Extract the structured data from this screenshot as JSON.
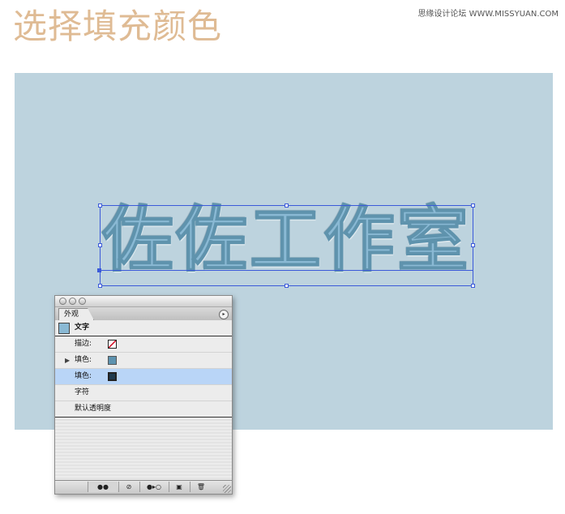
{
  "page": {
    "title": "选择填充颜色",
    "watermark": "思缘设计论坛 WWW.MISSYUAN.COM"
  },
  "artwork": {
    "text": "佐佐工作室"
  },
  "panel": {
    "tab_label": "外观",
    "menu_icon": "▸",
    "object_label": "文字",
    "rows": [
      {
        "label": "描边:",
        "swatch": "none-stroke"
      },
      {
        "label": "填色:",
        "swatch": "#5d92af",
        "expander": "▶"
      },
      {
        "label": "填色:",
        "swatch": "#1e3a4f",
        "selected": true
      },
      {
        "label": "字符"
      },
      {
        "label": "默认透明度"
      }
    ],
    "footer_buttons": [
      {
        "name": "new-art-basic-appearance",
        "glyph": "●●"
      },
      {
        "name": "clear-appearance",
        "glyph": "⊘"
      },
      {
        "name": "reduce-to-basic-appearance",
        "glyph": "●▸○"
      },
      {
        "name": "duplicate-item",
        "glyph": "▣"
      },
      {
        "name": "delete-item",
        "glyph": "🗑"
      }
    ]
  },
  "colors": {
    "title": "#dfbb94",
    "canvas": "#bdd3de",
    "selection": "#3b5ad9",
    "selected_row": "#b9d5f7"
  }
}
